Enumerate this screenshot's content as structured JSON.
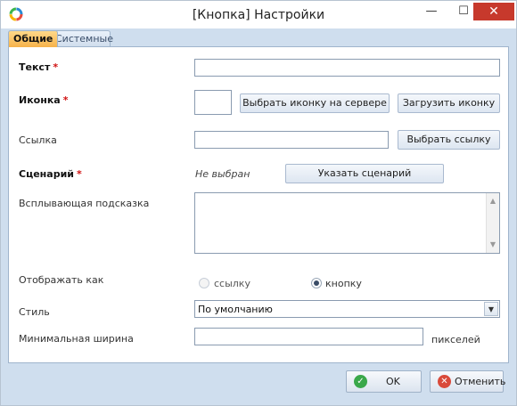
{
  "window": {
    "title": "[Кнопка] Настройки",
    "controls": {
      "minimize": "—",
      "maximize": "☐",
      "close": "✕"
    }
  },
  "tabs": [
    {
      "label": "Общие",
      "active": true
    },
    {
      "label": "Системные",
      "active": false
    }
  ],
  "form": {
    "text": {
      "label": "Текст",
      "required_mark": "*",
      "value": ""
    },
    "icon": {
      "label": "Иконка",
      "required_mark": "*",
      "choose_server_label": "Выбрать иконку на сервере",
      "upload_label": "Загрузить иконку"
    },
    "link": {
      "label": "Ссылка",
      "value": "",
      "choose_label": "Выбрать ссылку"
    },
    "scenario": {
      "label": "Сценарий",
      "required_mark": "*",
      "status": "Не выбран",
      "set_label": "Указать сценарий"
    },
    "tooltip": {
      "label": "Всплывающая подсказка",
      "value": ""
    },
    "display_as": {
      "label": "Отображать как",
      "options": [
        {
          "label": "ссылку",
          "selected": false,
          "enabled": false
        },
        {
          "label": "кнопку",
          "selected": true,
          "enabled": true
        }
      ]
    },
    "style": {
      "label": "Стиль",
      "value": "По умолчанию"
    },
    "min_width": {
      "label": "Минимальная ширина",
      "value": "",
      "unit": "пикселей"
    }
  },
  "footer": {
    "ok_label": "OK",
    "cancel_label": "Отменить"
  },
  "colors": {
    "accent_tab": "#f6b24a",
    "close_button": "#c7392c",
    "ok_icon": "#3aa84a",
    "cancel_icon": "#d94a3a",
    "required": "#d01010"
  },
  "icons": {
    "app": "app-ring-icon",
    "ok": "check-circle-icon",
    "cancel": "x-circle-icon",
    "dropdown": "chevron-down-icon"
  }
}
